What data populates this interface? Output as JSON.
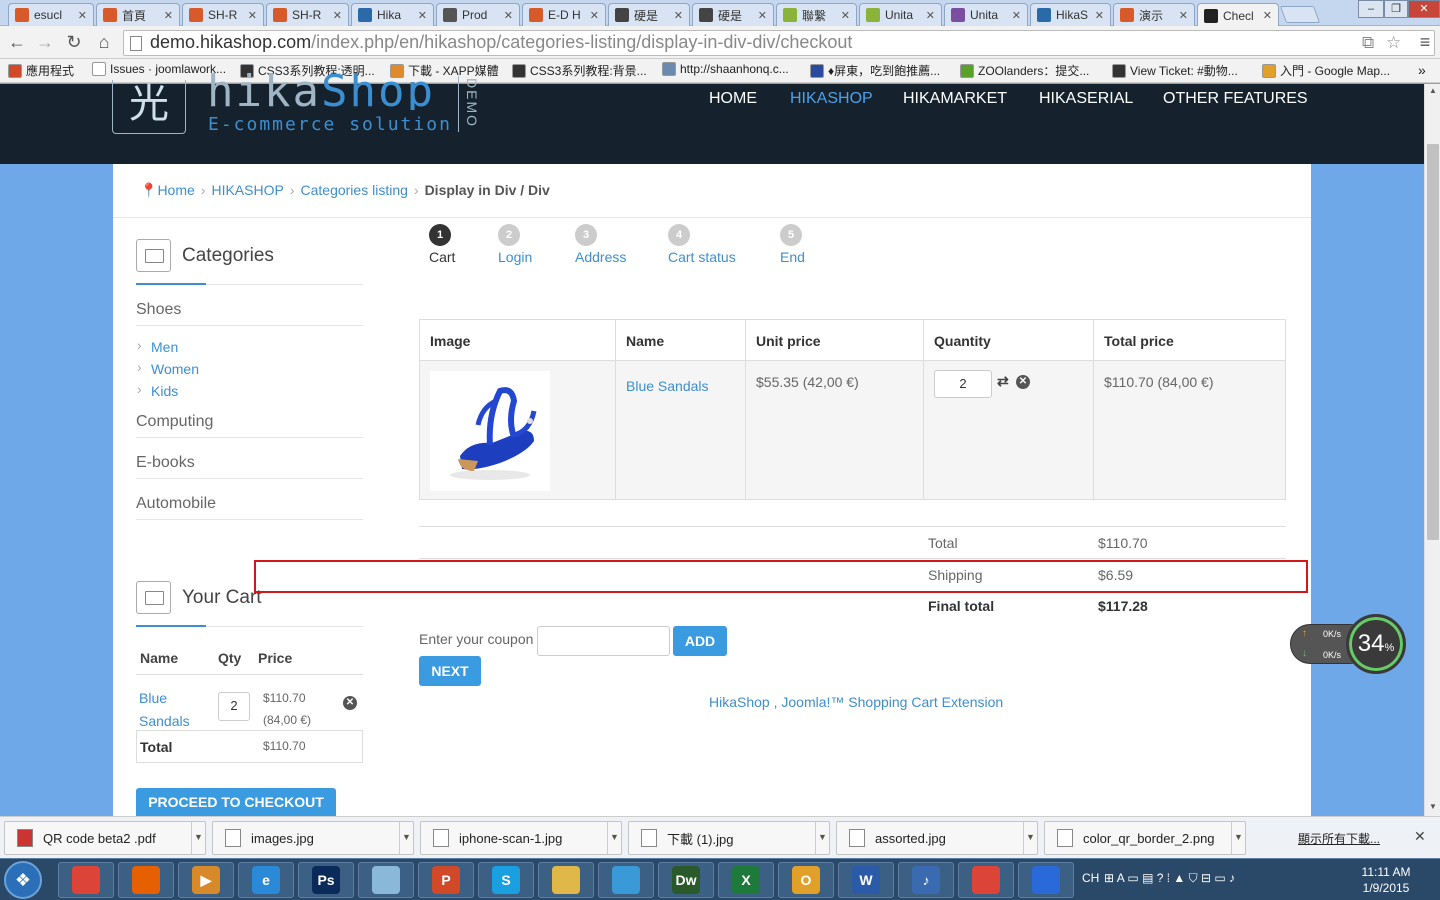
{
  "browser": {
    "tabs": [
      {
        "title": "esucl",
        "favicon_color": "#d85a2a"
      },
      {
        "title": "首頁",
        "favicon_color": "#d85a2a"
      },
      {
        "title": "SH-R",
        "favicon_color": "#d85a2a"
      },
      {
        "title": "SH-R",
        "favicon_color": "#d85a2a"
      },
      {
        "title": "Hika",
        "favicon_color": "#2b6aa8"
      },
      {
        "title": "Prod",
        "favicon_color": "#555555"
      },
      {
        "title": "E-D H",
        "favicon_color": "#d85a2a"
      },
      {
        "title": "硬是",
        "favicon_color": "#444444"
      },
      {
        "title": "硬是",
        "favicon_color": "#444444"
      },
      {
        "title": "聯繫",
        "favicon_color": "#8bb33a"
      },
      {
        "title": "Unita",
        "favicon_color": "#8bb33a"
      },
      {
        "title": "Unita",
        "favicon_color": "#7b4fa0"
      },
      {
        "title": "HikaS",
        "favicon_color": "#2b6aa8"
      },
      {
        "title": "演示",
        "favicon_color": "#d85a2a"
      },
      {
        "title": "Checl",
        "favicon_color": "#222222"
      }
    ],
    "url_domain": "demo.hikashop.com",
    "url_path": "/index.php/en/hikashop/categories-listing/display-in-div-div/checkout",
    "bookmarks": [
      {
        "label": "應用程式",
        "color": "#d04a2a"
      },
      {
        "label": "Issues · joomlawork...",
        "color": "#ffffff"
      },
      {
        "label": "CSS3系列教程:透明...",
        "color": "#333333"
      },
      {
        "label": "下載 - XAPP媒體",
        "color": "#e08a2a"
      },
      {
        "label": "CSS3系列教程:背景...",
        "color": "#333333"
      },
      {
        "label": "http://shaanhonq.c...",
        "color": "#6a8ab0"
      },
      {
        "label": "♦屏東，吃到飽推薦...",
        "color": "#2a4aa0"
      },
      {
        "label": "ZOOlanders：提交...",
        "color": "#5aa02a"
      },
      {
        "label": "View Ticket: #動物...",
        "color": "#333333"
      },
      {
        "label": "入門 - Google Map...",
        "color": "#e0a02a"
      }
    ]
  },
  "site": {
    "logo_char": "光",
    "logo_name_a": "hika",
    "logo_name_b": "Shop",
    "logo_sub": "E-commerce solution",
    "logo_demo": "DEMO",
    "nav": [
      "HOME",
      "HIKASHOP",
      "HIKAMARKET",
      "HIKASERIAL",
      "OTHER FEATURES"
    ]
  },
  "breadcrumb": [
    "Home",
    "HIKASHOP",
    "Categories listing",
    "Display in Div / Div"
  ],
  "sidebar": {
    "categories_title": "Categories",
    "categories": [
      "Shoes",
      "Computing",
      "E-books",
      "Automobile"
    ],
    "subcategories": [
      "Men",
      "Women",
      "Kids"
    ],
    "cart_title": "Your Cart",
    "cart_headers": [
      "Name",
      "Qty",
      "Price"
    ],
    "cart_item_name_1": "Blue",
    "cart_item_name_2": "Sandals",
    "cart_item_qty": "2",
    "cart_item_price_1": "$110.70",
    "cart_item_price_2": "(84,00 €)",
    "cart_total_label": "Total",
    "cart_total_value": "$110.70",
    "checkout_button": "PROCEED TO CHECKOUT"
  },
  "steps": [
    {
      "num": "1",
      "label": "Cart"
    },
    {
      "num": "2",
      "label": "Login"
    },
    {
      "num": "3",
      "label": "Address"
    },
    {
      "num": "4",
      "label": "Cart status"
    },
    {
      "num": "5",
      "label": "End"
    }
  ],
  "cart_table": {
    "headers": [
      "Image",
      "Name",
      "Unit price",
      "Quantity",
      "Total price"
    ],
    "product_name": "Blue Sandals",
    "unit_price": "$55.35 (42,00 €)",
    "quantity": "2",
    "total_price": "$110.70 (84,00 €)"
  },
  "totals": {
    "total_label": "Total",
    "total_value": "$110.70",
    "shipping_label": "Shipping",
    "shipping_value": "$6.59",
    "final_label": "Final total",
    "final_value": "$117.28"
  },
  "coupon": {
    "label": "Enter your coupon",
    "value": "",
    "add_button": "ADD"
  },
  "next_button": "NEXT",
  "footer_link": "HikaShop , Joomla!™ Shopping Cart Extension",
  "net_widget": {
    "up": "0K/s",
    "down": "0K/s",
    "percent": "34",
    "percent_sign": "%"
  },
  "downloads": {
    "items": [
      "QR code beta2 .pdf",
      "images.jpg",
      "iphone-scan-1.jpg",
      "下載 (1).jpg",
      "assorted.jpg",
      "color_qr_border_2.png"
    ],
    "show_all": "顯示所有下載..."
  },
  "taskbar": {
    "apps": [
      {
        "glyph": "",
        "color": "#db4437"
      },
      {
        "glyph": "",
        "color": "#e66000"
      },
      {
        "glyph": "▶",
        "color": "#d88a2a"
      },
      {
        "glyph": "e",
        "color": "#2a8ad8"
      },
      {
        "glyph": "Ps",
        "color": "#0a2a5a"
      },
      {
        "glyph": "",
        "color": "#8ab8d8"
      },
      {
        "glyph": "P",
        "color": "#d04a2a"
      },
      {
        "glyph": "S",
        "color": "#1aa0e0"
      },
      {
        "glyph": "",
        "color": "#e0b84a"
      },
      {
        "glyph": "",
        "color": "#3a9ad8"
      },
      {
        "glyph": "Dw",
        "color": "#2a5a2a"
      },
      {
        "glyph": "X",
        "color": "#1e7a3a"
      },
      {
        "glyph": "O",
        "color": "#e0a02a"
      },
      {
        "glyph": "W",
        "color": "#2a5aa8"
      },
      {
        "glyph": "♪",
        "color": "#3a6ab0"
      },
      {
        "glyph": "",
        "color": "#db4437"
      },
      {
        "glyph": "",
        "color": "#2a6ad8"
      }
    ],
    "lang": "CH",
    "time": "11:11 AM",
    "date": "1/9/2015"
  }
}
